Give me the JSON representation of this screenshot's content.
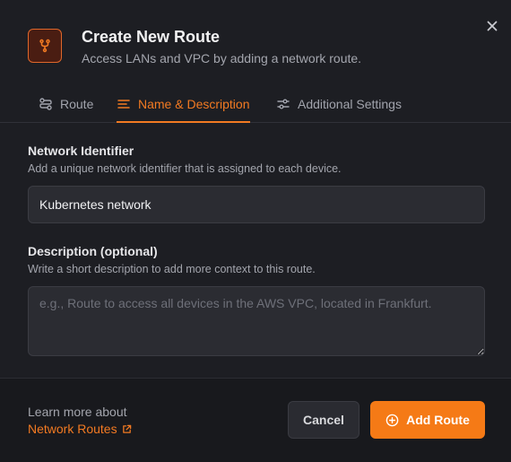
{
  "header": {
    "title": "Create New Route",
    "subtitle": "Access LANs and VPC by adding a network route.",
    "icon": "route-icon",
    "close_icon": "close-icon"
  },
  "tabs": [
    {
      "label": "Route",
      "icon": "route-settings-icon",
      "active": false
    },
    {
      "label": "Name & Description",
      "icon": "text-lines-icon",
      "active": true
    },
    {
      "label": "Additional Settings",
      "icon": "sliders-icon",
      "active": false
    }
  ],
  "form": {
    "network_identifier": {
      "label": "Network Identifier",
      "help": "Add a unique network identifier that is assigned to each device.",
      "value": "Kubernetes network"
    },
    "description": {
      "label": "Description (optional)",
      "help": "Write a short description to add more context to this route.",
      "placeholder": "e.g., Route to access all devices in the AWS VPC, located in Frankfurt.",
      "value": ""
    }
  },
  "footer": {
    "learn_more": "Learn more about",
    "link_label": "Network Routes",
    "cancel_label": "Cancel",
    "add_label": "Add Route"
  },
  "colors": {
    "accent": "#f57a16",
    "background": "#1d1e23",
    "footer_background": "#18191d",
    "input_background": "#2b2c32"
  }
}
